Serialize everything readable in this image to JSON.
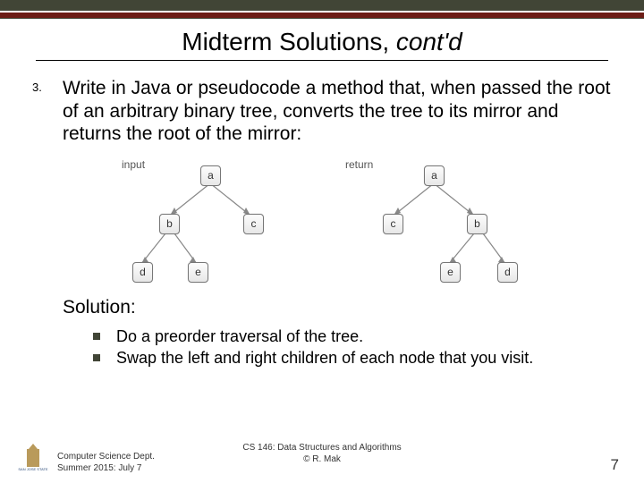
{
  "title_main": "Midterm Solutions, ",
  "title_italic": "cont'd",
  "question_number": "3.",
  "question_text": "Write in Java or pseudocode a method that, when passed the root of an arbitrary binary tree, converts the tree to its mirror and returns the root of the mirror:",
  "diagram": {
    "input_label": "input",
    "return_label": "return",
    "nodes": {
      "a": "a",
      "b": "b",
      "c": "c",
      "d": "d",
      "e": "e"
    }
  },
  "solution_label": "Solution:",
  "bullets": [
    "Do a preorder traversal of the tree.",
    "Swap the left and right children of each node that you visit."
  ],
  "footer": {
    "left_logo_text": "SAN JOSE STATE\nUNIVERSITY",
    "left_line1": "Computer Science Dept.",
    "left_line2": "Summer 2015: July 7",
    "center_line1": "CS 146: Data Structures and Algorithms",
    "center_line2": "© R. Mak",
    "page": "7"
  }
}
